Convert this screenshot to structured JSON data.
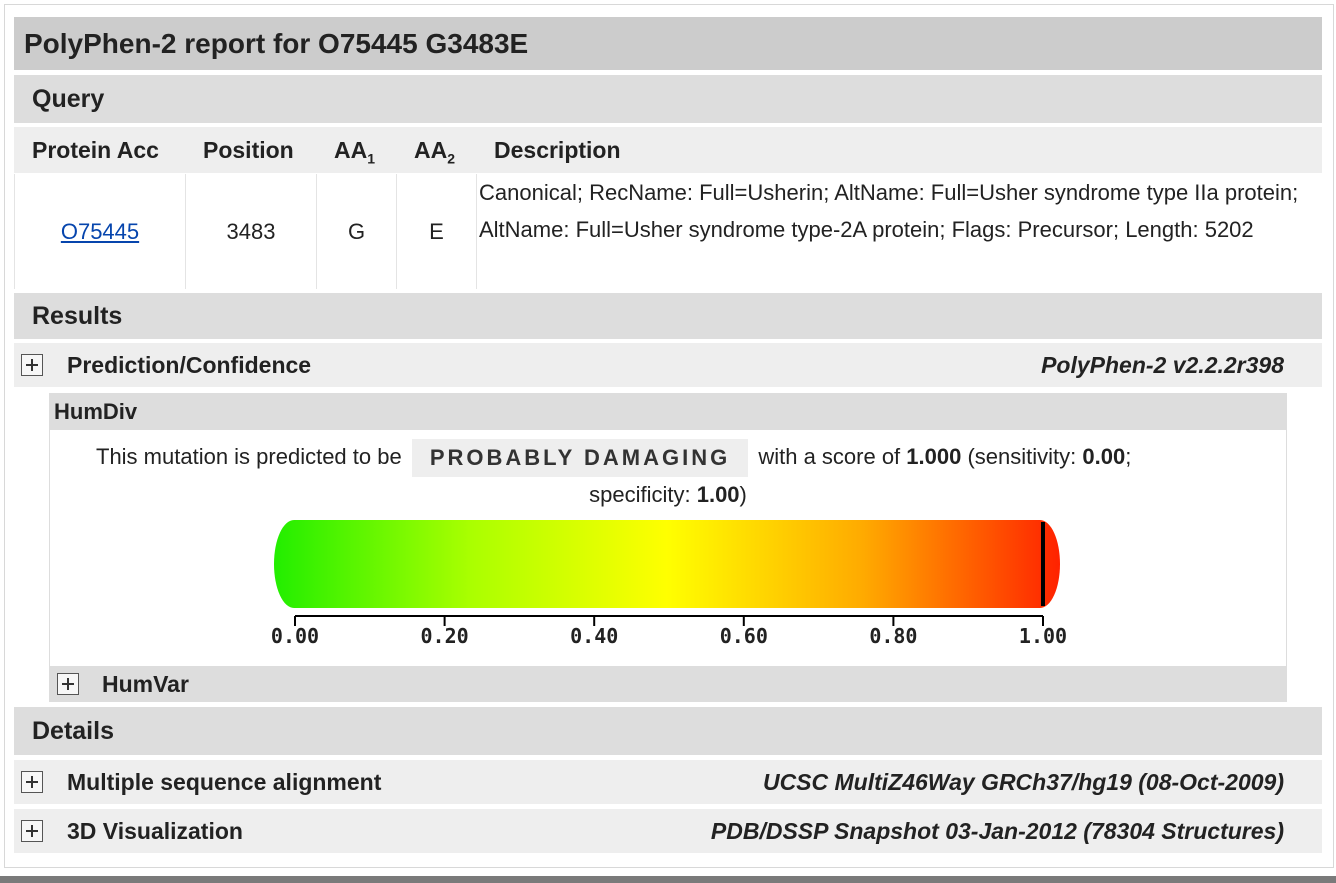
{
  "title": "PolyPhen-2 report for O75445 G3483E",
  "query": {
    "section_label": "Query",
    "headers": {
      "protein_acc": "Protein Acc",
      "position": "Position",
      "aa1_base": "AA",
      "aa1_sub": "1",
      "aa2_base": "AA",
      "aa2_sub": "2",
      "description": "Description"
    },
    "row": {
      "protein_acc": "O75445",
      "position": "3483",
      "aa1": "G",
      "aa2": "E",
      "description": "Canonical; RecName: Full=Usherin; AltName: Full=Usher syndrome type IIa protein; AltName: Full=Usher syndrome type-2A protein; Flags: Precursor; Length: 5202"
    }
  },
  "results": {
    "section_label": "Results",
    "prediction_label": "Prediction/Confidence",
    "prediction_version": "PolyPhen-2 v2.2.2r398",
    "humdiv": {
      "label": "HumDiv",
      "text_before": "This mutation is predicted to be",
      "verdict": "PROBABLY DAMAGING",
      "text_score": "with a score of",
      "score": "1.000",
      "text_sens": "(sensitivity:",
      "sensitivity": "0.00",
      "text_spec": "specificity:",
      "specificity": "1.00",
      "score_value": 1.0,
      "scale_ticks": [
        "0.00",
        "0.20",
        "0.40",
        "0.60",
        "0.80",
        "1.00"
      ],
      "gradient_colors": [
        "#22ee00",
        "#aaff00",
        "#ffff00",
        "#ffaa00",
        "#ff2200"
      ]
    },
    "humvar_label": "HumVar"
  },
  "details": {
    "section_label": "Details",
    "items": [
      {
        "label": "Multiple sequence alignment",
        "source": "UCSC MultiZ46Way GRCh37/hg19 (08-Oct-2009)"
      },
      {
        "label": "3D Visualization",
        "source": "PDB/DSSP Snapshot 03-Jan-2012 (78304 Structures)"
      }
    ]
  }
}
